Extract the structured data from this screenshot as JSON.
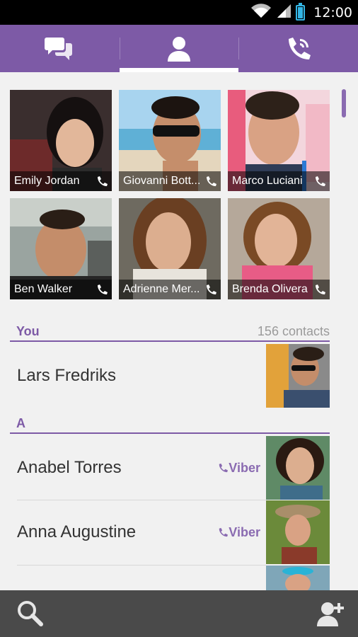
{
  "status_bar": {
    "time": "12:00",
    "icons": [
      "wifi-icon",
      "signal-icon",
      "battery-icon"
    ],
    "battery_color": "#33b5e5"
  },
  "tabs": [
    {
      "id": "chats",
      "icon": "chat-bubbles-icon",
      "active": false
    },
    {
      "id": "contacts",
      "icon": "contact-person-icon",
      "active": true
    },
    {
      "id": "calls",
      "icon": "phone-call-icon",
      "active": false
    }
  ],
  "theme": {
    "accent": "#7d5aa6",
    "bottom_bar": "#4a4a4a",
    "background": "#f1f1f1"
  },
  "favorites": [
    {
      "name": "Emily Jordan",
      "icon": "viber-phone-icon"
    },
    {
      "name": "Giovanni Bott...",
      "icon": "viber-phone-icon"
    },
    {
      "name": "Marco Luciani",
      "icon": "viber-phone-icon"
    },
    {
      "name": "Ben Walker",
      "icon": "viber-phone-icon"
    },
    {
      "name": "Adrienne Mer...",
      "icon": "viber-phone-icon"
    },
    {
      "name": "Brenda Olivera",
      "icon": "viber-phone-icon"
    }
  ],
  "you_section": {
    "label": "You",
    "count": "156 contacts",
    "contact": {
      "name": "Lars Fredriks"
    }
  },
  "section_a": {
    "label": "A",
    "contacts": [
      {
        "name": "Anabel Torres",
        "badge": "Viber"
      },
      {
        "name": "Anna Augustine",
        "badge": "Viber"
      }
    ]
  },
  "bottom_bar": {
    "left_icon": "search-icon",
    "right_icon": "add-contact-icon"
  }
}
